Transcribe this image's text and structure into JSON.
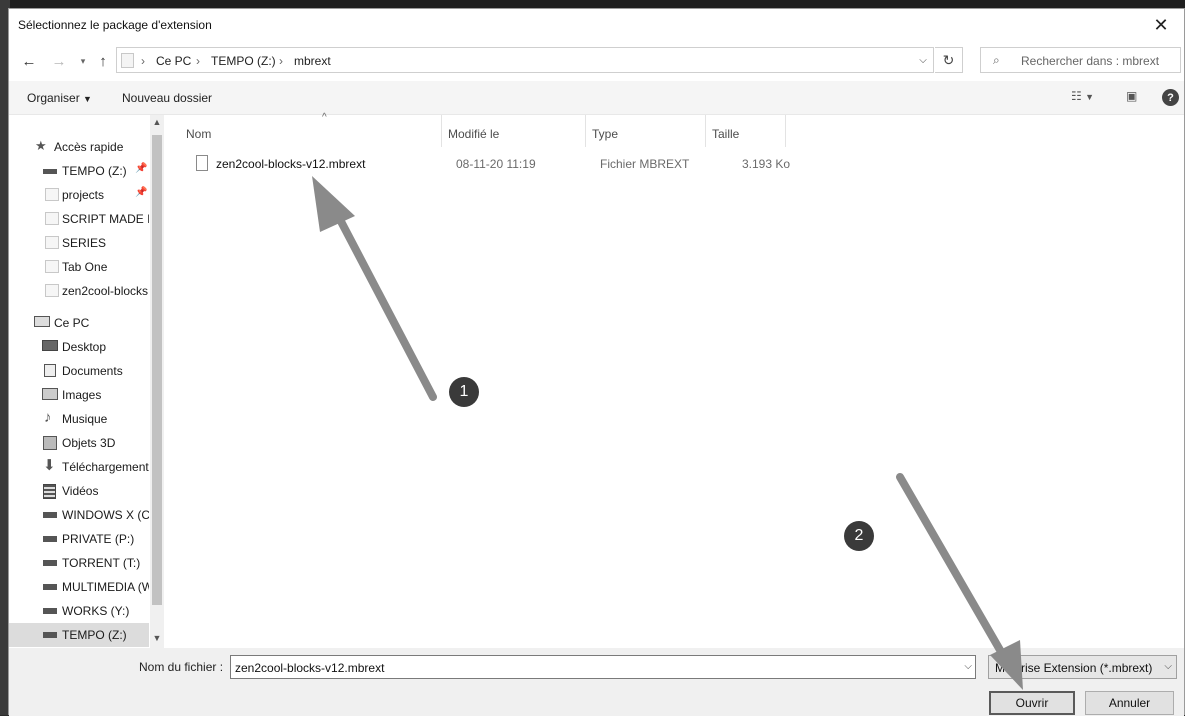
{
  "window": {
    "title": "Sélectionnez le package d'extension",
    "close_symbol": "✕"
  },
  "address": {
    "breadcrumbs": [
      "Ce PC",
      "TEMPO (Z:)",
      "mbrext"
    ],
    "separator": "›",
    "search_placeholder": "Rechercher dans : mbrext"
  },
  "toolbar": {
    "organize_label": "Organiser",
    "new_folder_label": "Nouveau dossier",
    "help_label": "?"
  },
  "sidebar": {
    "items": [
      {
        "label": "Accès rapide",
        "icon": "star-icon",
        "pinned": false
      },
      {
        "label": "TEMPO (Z:)",
        "icon": "drive-icon",
        "pinned": true
      },
      {
        "label": "projects",
        "icon": "folder-icon",
        "pinned": true
      },
      {
        "label": "SCRIPT MADE IN",
        "icon": "folder-icon",
        "pinned": false
      },
      {
        "label": "SERIES",
        "icon": "folder-icon",
        "pinned": false
      },
      {
        "label": "Tab One",
        "icon": "folder-icon",
        "pinned": false
      },
      {
        "label": "zen2cool-blocks",
        "icon": "folder-icon",
        "pinned": false
      },
      {
        "label": "Ce PC",
        "icon": "computer-icon",
        "pinned": false
      },
      {
        "label": "Desktop",
        "icon": "desktop-icon",
        "pinned": false
      },
      {
        "label": "Documents",
        "icon": "documents-icon",
        "pinned": false
      },
      {
        "label": "Images",
        "icon": "images-icon",
        "pinned": false
      },
      {
        "label": "Musique",
        "icon": "music-icon",
        "pinned": false
      },
      {
        "label": "Objets 3D",
        "icon": "cube-icon",
        "pinned": false
      },
      {
        "label": "Téléchargements",
        "icon": "download-icon",
        "pinned": false
      },
      {
        "label": "Vidéos",
        "icon": "video-icon",
        "pinned": false
      },
      {
        "label": "WINDOWS X (C:",
        "icon": "drive-icon",
        "pinned": false
      },
      {
        "label": "PRIVATE (P:)",
        "icon": "drive-icon",
        "pinned": false
      },
      {
        "label": "TORRENT (T:)",
        "icon": "drive-icon",
        "pinned": false
      },
      {
        "label": "MULTIMEDIA (W",
        "icon": "drive-icon",
        "pinned": false
      },
      {
        "label": "WORKS (Y:)",
        "icon": "drive-icon",
        "pinned": false
      },
      {
        "label": "TEMPO (Z:)",
        "icon": "drive-icon",
        "pinned": false,
        "selected": true
      }
    ]
  },
  "columns": {
    "name": "Nom",
    "modified": "Modifié le",
    "type": "Type",
    "size": "Taille"
  },
  "files": [
    {
      "name": "zen2cool-blocks-v12.mbrext",
      "modified": "08-11-20 11:19",
      "type": "Fichier MBREXT",
      "size": "3.193 Ko"
    }
  ],
  "footer": {
    "filename_label": "Nom du fichier :",
    "filename_value": "zen2cool-blocks-v12.mbrext",
    "filter_value": "Mobirise Extension  (*.mbrext)",
    "open_label": "Ouvrir",
    "cancel_label": "Annuler"
  },
  "annotations": {
    "badge_1": "1",
    "badge_2": "2"
  }
}
